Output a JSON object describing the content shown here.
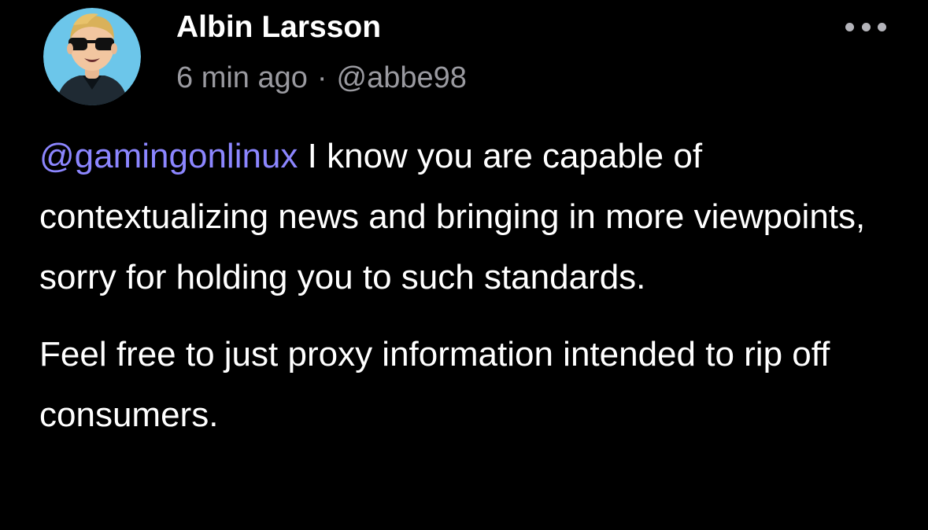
{
  "post": {
    "author": {
      "display_name": "Albin Larsson",
      "handle": "@abbe98",
      "avatar_icon": "memoji-avatar-icon"
    },
    "timestamp": "6 min ago",
    "separator": "·",
    "more_icon": "more-options-icon",
    "body": {
      "mention": "@gamingonlinux",
      "paragraph1_rest": " I know you are capable of contextualizing news and bringing in more viewpoints, sorry for holding you to such standards.",
      "paragraph2": "Feel free to just proxy information intended to rip off consumers."
    }
  },
  "colors": {
    "background": "#000000",
    "text": "#ffffff",
    "meta_text": "#9a9aa0",
    "mention": "#8c86ff",
    "avatar_bg": "#6cc6ea"
  }
}
